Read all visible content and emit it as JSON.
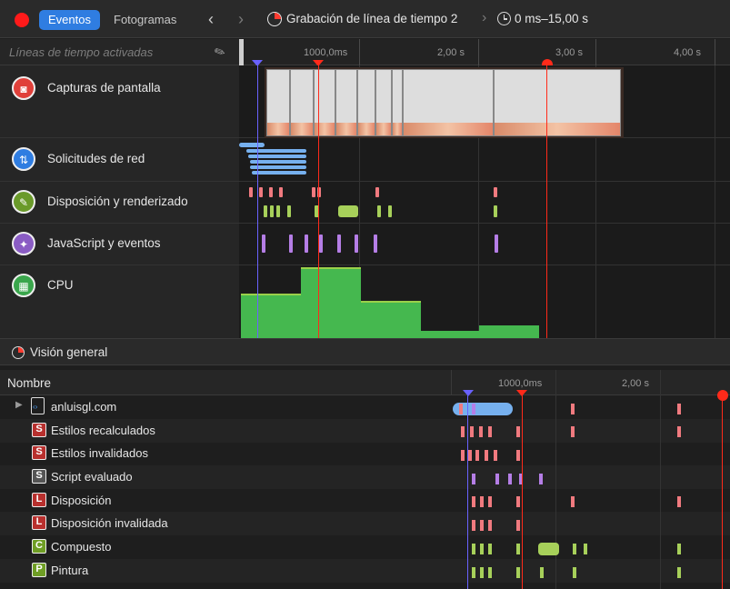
{
  "toolbar": {
    "tab_events": "Eventos",
    "tab_frames": "Fotogramas",
    "recording_title": "Grabación de línea de tiempo 2",
    "time_range": "0 ms–15,00 s"
  },
  "filter": {
    "placeholder": "Líneas de tiempo activadas"
  },
  "ruler": {
    "ticks": [
      "1000,0ms",
      "2,00 s",
      "3,00 s",
      "4,00 s"
    ]
  },
  "lanes": [
    {
      "label": "Capturas de pantalla",
      "icon": "camera-icon",
      "color": "#e0403a"
    },
    {
      "label": "Solicitudes de red",
      "icon": "network-arrows-icon",
      "color": "#2f7de1"
    },
    {
      "label": "Disposición y renderizado",
      "icon": "paintbrush-icon",
      "color": "#6a9a2a"
    },
    {
      "label": "JavaScript y eventos",
      "icon": "script-icon",
      "color": "#8a5cc4"
    },
    {
      "label": "CPU",
      "icon": "cpu-chip-icon",
      "color": "#3aa64c"
    }
  ],
  "overview": {
    "label": "Visión general"
  },
  "table": {
    "column_name": "Nombre",
    "ticks": [
      "1000,0ms",
      "2,00 s"
    ],
    "rows": [
      {
        "label": "anluisgl.com",
        "badge": "",
        "badge_color": ""
      },
      {
        "label": "Estilos recalculados",
        "badge": "S",
        "badge_color": "#b8302e"
      },
      {
        "label": "Estilos invalidados",
        "badge": "S",
        "badge_color": "#b8302e"
      },
      {
        "label": "Script evaluado",
        "badge": "S",
        "badge_color": "#555555"
      },
      {
        "label": "Disposición",
        "badge": "L",
        "badge_color": "#b8302e"
      },
      {
        "label": "Disposición invalidada",
        "badge": "L",
        "badge_color": "#b8302e"
      },
      {
        "label": "Compuesto",
        "badge": "C",
        "badge_color": "#6f9e25"
      },
      {
        "label": "Pintura",
        "badge": "P",
        "badge_color": "#6f9e25"
      }
    ]
  },
  "colors": {
    "layout_red": "#f07a7f",
    "paint_green": "#a7d05a",
    "script_purple": "#b57ee6",
    "network_blue": "#76b0ee",
    "cpu_green": "#45b84f",
    "playhead_red": "#ff2a1a",
    "marker_blue": "#6a62ff"
  }
}
